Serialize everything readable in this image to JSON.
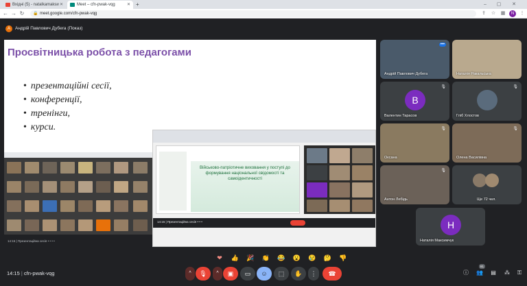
{
  "browser": {
    "tabs": [
      {
        "label": "Вхідні (5) - natalkamaksи",
        "color": "#ea4335"
      },
      {
        "label": "Meet – cfn-pwak-vqg",
        "color": "#00897b"
      }
    ],
    "url": "meet.google.com/cfn-pwak-vqg"
  },
  "meet": {
    "presenter": "Андрій Павлович Дубега (Показ)",
    "presenter_initial": "А",
    "meeting_code": "cfn-pwak-vqg",
    "time": "14:15"
  },
  "slide": {
    "title": "Просвітницька робота з педагогами",
    "bullets": [
      "презентаційні сесії,",
      "конференції,",
      "тренінги,",
      "курси."
    ]
  },
  "inner_slide": {
    "title": "Військово-патріотичне виховання у поступі до формування національної свідомості та самоідентичності"
  },
  "participants": [
    {
      "name": "Андрій Павлович Дубега",
      "color": "#4a5a6a"
    },
    {
      "name": "Наталія Ракальська",
      "color": "#b9a98e"
    },
    {
      "name": "Валентин Тарасов",
      "initial": "B",
      "color": "#7b2cbf"
    },
    {
      "name": "Гліб Хлостов",
      "color": "#5a6b7c"
    },
    {
      "name": "Оксана",
      "color": "#8a7a60"
    },
    {
      "name": "Олена Василівна",
      "color": "#7d6b58"
    },
    {
      "name": "Антон Лебідь",
      "color": "#6b6158"
    },
    {
      "name": "Ще 72 чел.",
      "color": "#3c4043"
    },
    {
      "name": "Наталія Максимчук",
      "initial": "Н",
      "color": "#7b2cbf"
    }
  ],
  "reactions": [
    "❤",
    "👍",
    "🎉",
    "👏",
    "😂",
    "😮",
    "😢",
    "🤔",
    "👎"
  ],
  "participant_count": "81"
}
